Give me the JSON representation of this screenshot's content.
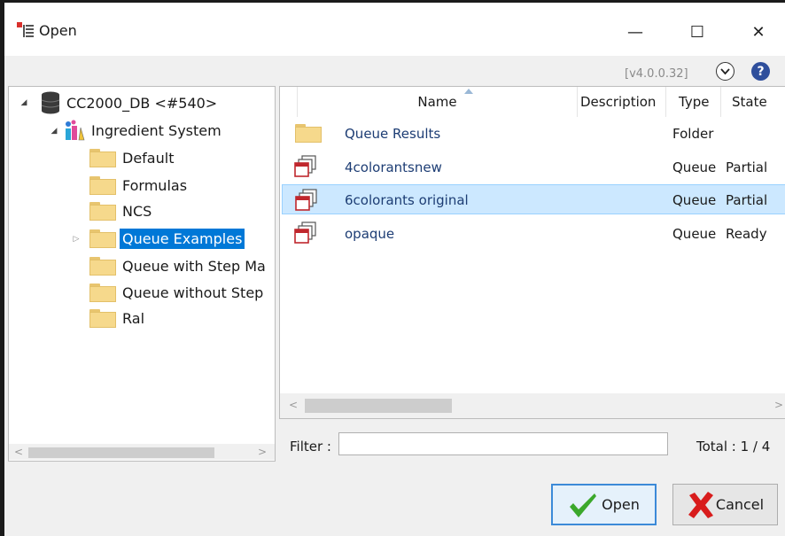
{
  "window": {
    "title": "Open",
    "minimize_glyph": "—",
    "maximize_glyph": "☐",
    "close_glyph": "✕"
  },
  "toolbar": {
    "version": "[v4.0.0.32]",
    "dropdown_icon": "chevron-down-circle",
    "help_icon": "help-circle",
    "help_glyph": "?"
  },
  "tree": {
    "root": "CC2000_DB <#540>",
    "system": "Ingredient System",
    "folders": [
      "Default",
      "Formulas",
      "NCS",
      "Queue Examples",
      "Queue with Step Ma",
      "Queue without Step",
      "Ral"
    ],
    "selected_folder": "Queue Examples"
  },
  "list": {
    "columns": [
      "Name",
      "Description",
      "Type",
      "State"
    ],
    "rows": [
      {
        "name": "Queue Results",
        "description": "",
        "type": "Folder",
        "state": "",
        "icon": "folder-icon"
      },
      {
        "name": "4colorantsnew",
        "description": "",
        "type": "Queue",
        "state": "Partial",
        "icon": "queue-icon"
      },
      {
        "name": "6colorants original",
        "description": "",
        "type": "Queue",
        "state": "Partial",
        "icon": "queue-icon"
      },
      {
        "name": "opaque",
        "description": "",
        "type": "Queue",
        "state": "Ready",
        "icon": "queue-icon"
      }
    ],
    "selected_row": "6colorants original"
  },
  "filter": {
    "label": "Filter :",
    "value": "",
    "total": "Total : 1 / 4"
  },
  "buttons": {
    "open": "Open",
    "cancel": "Cancel"
  },
  "colors": {
    "selection": "#0078d7",
    "row_selection": "#cce8ff",
    "folder": "#f6d98c",
    "check": "#3ba82b",
    "cancel_x": "#d81c1c",
    "help": "#2f4f9c"
  }
}
